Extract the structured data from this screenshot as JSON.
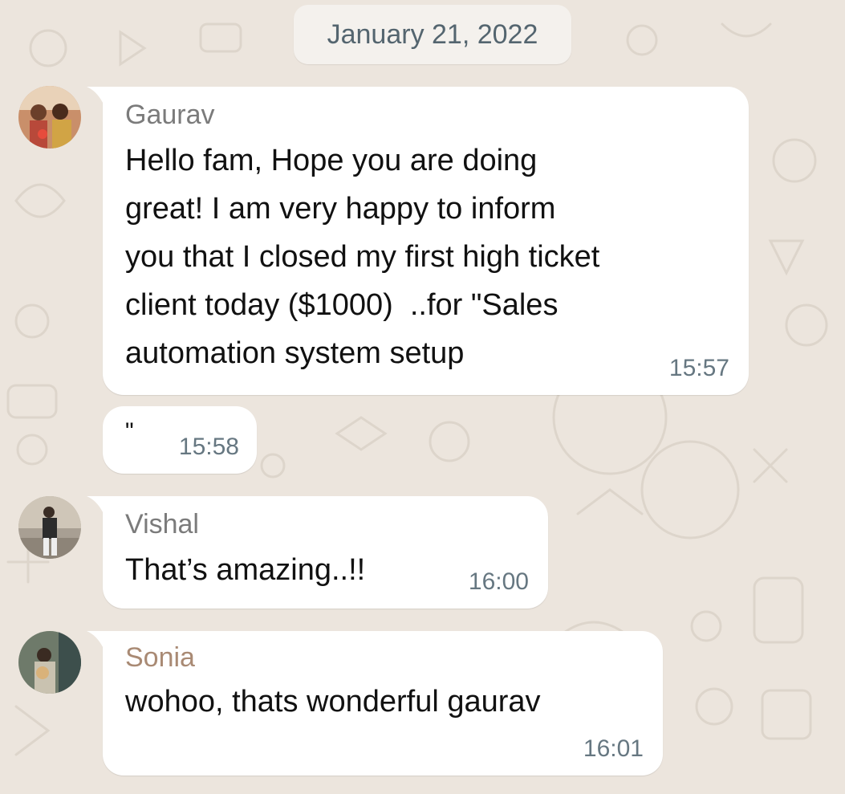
{
  "date_chip": "January 21, 2022",
  "messages": [
    {
      "sender": "Gaurav",
      "text": "Hello fam, Hope you are doing\ngreat! I am very happy to inform\nyou that I closed my first high ticket\nclient today ($1000)  ..for \"Sales\nautomation system setup",
      "time": "15:57"
    },
    {
      "sender": "",
      "text": "\"",
      "time": "15:58"
    },
    {
      "sender": "Vishal",
      "text": "That’s amazing..!!",
      "time": "16:00"
    },
    {
      "sender": "Sonia",
      "text": "wohoo, thats wonderful gaurav",
      "time": "16:01"
    }
  ],
  "colors": {
    "background": "#ece5dd",
    "bubble": "#ffffff",
    "sender_default": "#7b7b7b",
    "sender_sonia": "#a98a74",
    "timestamp": "#667781"
  },
  "icons": {
    "gaurav_avatar": "avatar-gaurav",
    "vishal_avatar": "avatar-vishal",
    "sonia_avatar": "avatar-sonia"
  }
}
